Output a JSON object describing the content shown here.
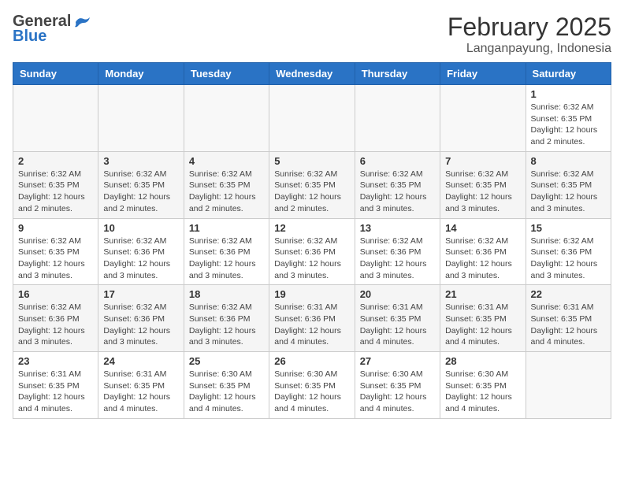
{
  "header": {
    "logo_general": "General",
    "logo_blue": "Blue",
    "month_year": "February 2025",
    "location": "Langanpayung, Indonesia"
  },
  "days_of_week": [
    "Sunday",
    "Monday",
    "Tuesday",
    "Wednesday",
    "Thursday",
    "Friday",
    "Saturday"
  ],
  "weeks": [
    [
      {
        "day": "",
        "info": ""
      },
      {
        "day": "",
        "info": ""
      },
      {
        "day": "",
        "info": ""
      },
      {
        "day": "",
        "info": ""
      },
      {
        "day": "",
        "info": ""
      },
      {
        "day": "",
        "info": ""
      },
      {
        "day": "1",
        "info": "Sunrise: 6:32 AM\nSunset: 6:35 PM\nDaylight: 12 hours\nand 2 minutes."
      }
    ],
    [
      {
        "day": "2",
        "info": "Sunrise: 6:32 AM\nSunset: 6:35 PM\nDaylight: 12 hours\nand 2 minutes."
      },
      {
        "day": "3",
        "info": "Sunrise: 6:32 AM\nSunset: 6:35 PM\nDaylight: 12 hours\nand 2 minutes."
      },
      {
        "day": "4",
        "info": "Sunrise: 6:32 AM\nSunset: 6:35 PM\nDaylight: 12 hours\nand 2 minutes."
      },
      {
        "day": "5",
        "info": "Sunrise: 6:32 AM\nSunset: 6:35 PM\nDaylight: 12 hours\nand 2 minutes."
      },
      {
        "day": "6",
        "info": "Sunrise: 6:32 AM\nSunset: 6:35 PM\nDaylight: 12 hours\nand 3 minutes."
      },
      {
        "day": "7",
        "info": "Sunrise: 6:32 AM\nSunset: 6:35 PM\nDaylight: 12 hours\nand 3 minutes."
      },
      {
        "day": "8",
        "info": "Sunrise: 6:32 AM\nSunset: 6:35 PM\nDaylight: 12 hours\nand 3 minutes."
      }
    ],
    [
      {
        "day": "9",
        "info": "Sunrise: 6:32 AM\nSunset: 6:35 PM\nDaylight: 12 hours\nand 3 minutes."
      },
      {
        "day": "10",
        "info": "Sunrise: 6:32 AM\nSunset: 6:36 PM\nDaylight: 12 hours\nand 3 minutes."
      },
      {
        "day": "11",
        "info": "Sunrise: 6:32 AM\nSunset: 6:36 PM\nDaylight: 12 hours\nand 3 minutes."
      },
      {
        "day": "12",
        "info": "Sunrise: 6:32 AM\nSunset: 6:36 PM\nDaylight: 12 hours\nand 3 minutes."
      },
      {
        "day": "13",
        "info": "Sunrise: 6:32 AM\nSunset: 6:36 PM\nDaylight: 12 hours\nand 3 minutes."
      },
      {
        "day": "14",
        "info": "Sunrise: 6:32 AM\nSunset: 6:36 PM\nDaylight: 12 hours\nand 3 minutes."
      },
      {
        "day": "15",
        "info": "Sunrise: 6:32 AM\nSunset: 6:36 PM\nDaylight: 12 hours\nand 3 minutes."
      }
    ],
    [
      {
        "day": "16",
        "info": "Sunrise: 6:32 AM\nSunset: 6:36 PM\nDaylight: 12 hours\nand 3 minutes."
      },
      {
        "day": "17",
        "info": "Sunrise: 6:32 AM\nSunset: 6:36 PM\nDaylight: 12 hours\nand 3 minutes."
      },
      {
        "day": "18",
        "info": "Sunrise: 6:32 AM\nSunset: 6:36 PM\nDaylight: 12 hours\nand 3 minutes."
      },
      {
        "day": "19",
        "info": "Sunrise: 6:31 AM\nSunset: 6:36 PM\nDaylight: 12 hours\nand 4 minutes."
      },
      {
        "day": "20",
        "info": "Sunrise: 6:31 AM\nSunset: 6:35 PM\nDaylight: 12 hours\nand 4 minutes."
      },
      {
        "day": "21",
        "info": "Sunrise: 6:31 AM\nSunset: 6:35 PM\nDaylight: 12 hours\nand 4 minutes."
      },
      {
        "day": "22",
        "info": "Sunrise: 6:31 AM\nSunset: 6:35 PM\nDaylight: 12 hours\nand 4 minutes."
      }
    ],
    [
      {
        "day": "23",
        "info": "Sunrise: 6:31 AM\nSunset: 6:35 PM\nDaylight: 12 hours\nand 4 minutes."
      },
      {
        "day": "24",
        "info": "Sunrise: 6:31 AM\nSunset: 6:35 PM\nDaylight: 12 hours\nand 4 minutes."
      },
      {
        "day": "25",
        "info": "Sunrise: 6:30 AM\nSunset: 6:35 PM\nDaylight: 12 hours\nand 4 minutes."
      },
      {
        "day": "26",
        "info": "Sunrise: 6:30 AM\nSunset: 6:35 PM\nDaylight: 12 hours\nand 4 minutes."
      },
      {
        "day": "27",
        "info": "Sunrise: 6:30 AM\nSunset: 6:35 PM\nDaylight: 12 hours\nand 4 minutes."
      },
      {
        "day": "28",
        "info": "Sunrise: 6:30 AM\nSunset: 6:35 PM\nDaylight: 12 hours\nand 4 minutes."
      },
      {
        "day": "",
        "info": ""
      }
    ]
  ]
}
